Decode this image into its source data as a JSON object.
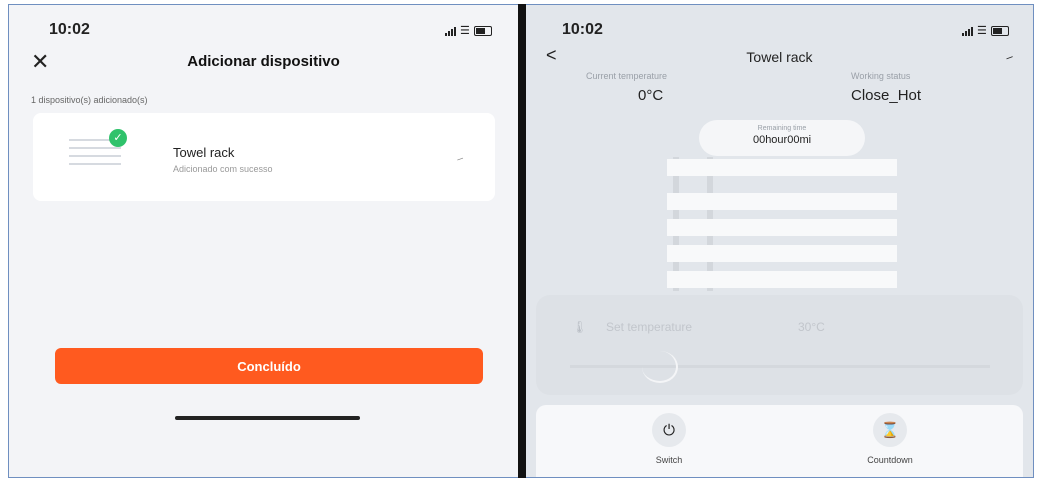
{
  "left_screen": {
    "time": "10:02",
    "title": "Adicionar dispositivo",
    "added_count": "1 dispositivo(s) adicionado(s)",
    "device": {
      "name": "Towel rack",
      "status": "Adicionado com sucesso"
    },
    "done_button": "Concluído"
  },
  "right_screen": {
    "time": "10:02",
    "title": "Towel rack",
    "current_temperature_label": "Current temperature",
    "current_temperature_value": "0°C",
    "working_status_label": "Working status",
    "working_status_value": "Close_Hot",
    "remaining_time_label": "Remaining time",
    "remaining_time_value": "00hour00mi",
    "set_temperature_label": "Set temperature",
    "set_temperature_value": "30°C",
    "controls": {
      "switch_label": "Switch",
      "countdown_label": "Countdown"
    }
  },
  "colors": {
    "accent": "#ff5a1f",
    "success": "#2fc26b"
  },
  "icons": [
    "close-icon",
    "check-icon",
    "edit-icon",
    "back-icon",
    "power-icon",
    "hourglass-icon",
    "thermometer-icon",
    "wifi-icon",
    "battery-icon",
    "signal-icon"
  ]
}
